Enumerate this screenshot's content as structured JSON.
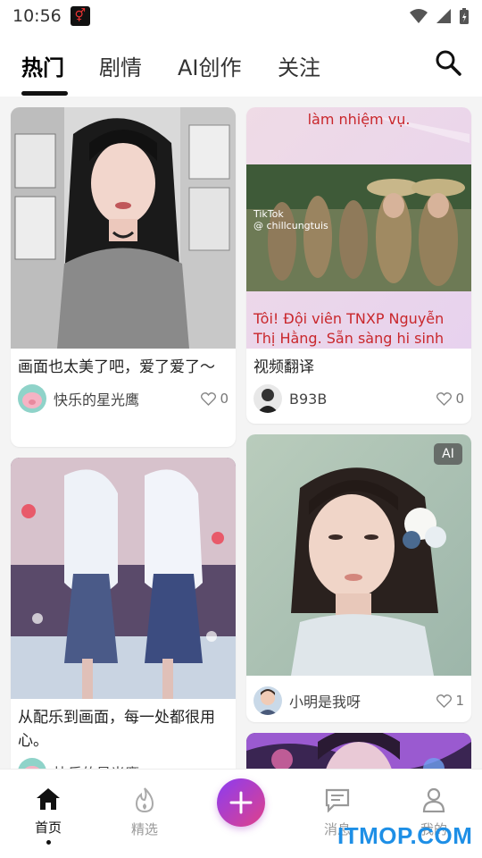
{
  "status_bar": {
    "time": "10:56",
    "app_icon": "gender-symbol-icon"
  },
  "tabs": [
    {
      "label": "热门",
      "active": true
    },
    {
      "label": "剧情",
      "active": false
    },
    {
      "label": "AI创作",
      "active": false
    },
    {
      "label": "关注",
      "active": false
    }
  ],
  "feed": {
    "cards": [
      {
        "title": "画面也太美了吧，爱了爱了～",
        "author": "快乐的星光鹰",
        "likes": "0",
        "badge": ""
      },
      {
        "title": "视频翻译",
        "author": "B93B",
        "likes": "0",
        "badge": "",
        "overlay_top": "làm nhiệm vụ.",
        "overlay_bottom": "Tôi!  Đội viên TNXP Nguyễn Thị Hằng. Sẵn sàng hi sinh",
        "tiktok_logo": "TikTok",
        "tiktok_user": "@ chillcungtuis"
      },
      {
        "title": "从配乐到画面，每一处都很用心。",
        "author": "快乐的星光鹰",
        "likes": "",
        "badge": ""
      },
      {
        "title": "",
        "author": "小明是我呀",
        "likes": "1",
        "badge": "AI"
      }
    ]
  },
  "bottom_nav": [
    {
      "label": "首页",
      "icon": "home-icon",
      "active": true
    },
    {
      "label": "精选",
      "icon": "flame-icon",
      "active": false
    },
    {
      "label": "消息",
      "icon": "message-icon",
      "active": false
    },
    {
      "label": "我的",
      "icon": "profile-icon",
      "active": false
    }
  ],
  "fab": {
    "icon": "plus-icon"
  },
  "watermark": "ITMOP.COM",
  "colors": {
    "accent_start": "#8b3cf2",
    "accent_end": "#e0418a",
    "watermark": "#1e8fe6"
  }
}
